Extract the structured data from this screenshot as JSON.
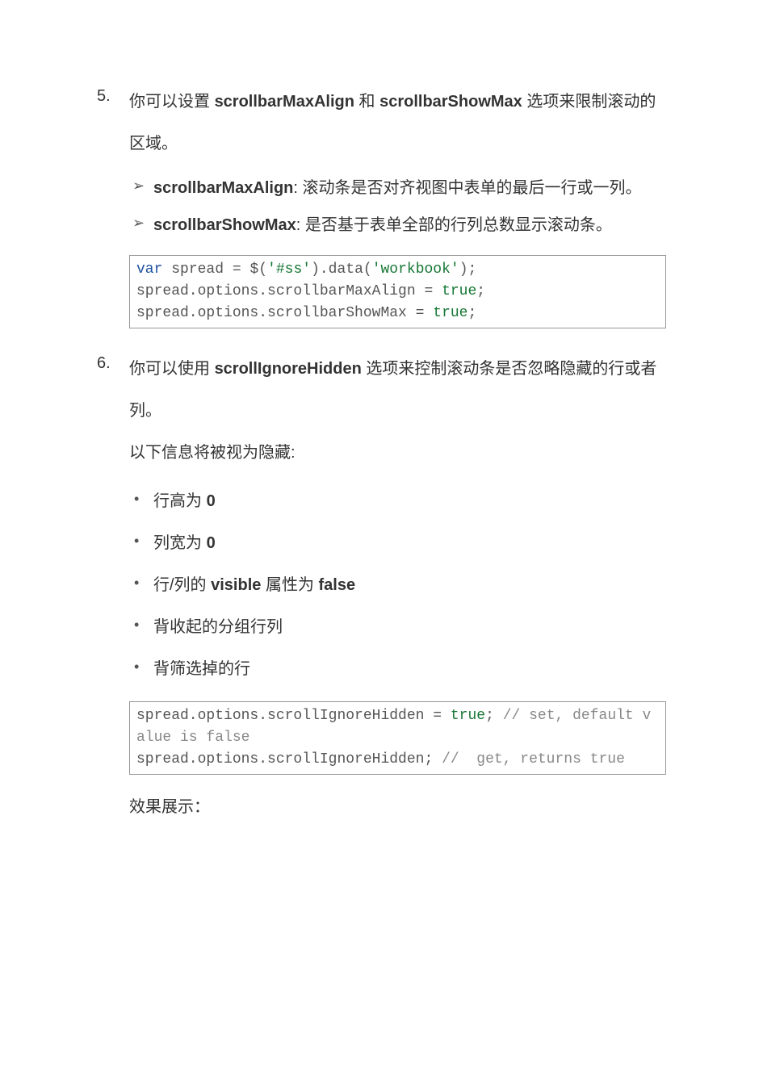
{
  "items": [
    {
      "number": "5.",
      "text_parts": {
        "p1": "你可以设置 ",
        "kw1": "scrollbarMaxAlign",
        "p2": " 和 ",
        "kw2": "scrollbarShowMax",
        "p3": " 选项来限制滚动的区域。"
      },
      "arrow_bullets": [
        {
          "label": "scrollbarMaxAlign",
          "desc": ": 滚动条是否对齐视图中表单的最后一行或一列。"
        },
        {
          "label": "scrollbarShowMax",
          "desc": ": 是否基于表单全部的行列总数显示滚动条。"
        }
      ],
      "code": {
        "kw_var": "var",
        "id_spread": "spread",
        "eq": " = ",
        "dollar": "$(",
        "str_sel": "'#ss'",
        "after_sel": ").data(",
        "str_wb": "'workbook'",
        "close1": ");",
        "line2_a": "spread.options.scrollbarMaxAlign = ",
        "true1": "true",
        "semi": ";",
        "line3_a": "spread.options.scrollbarShowMax = ",
        "true2": "true"
      }
    },
    {
      "number": "6.",
      "text_parts": {
        "p1": "你可以使用  ",
        "kw1": "scrollIgnoreHidden",
        "p2": " 选项来控制滚动条是否忽略隐藏的行或者列。"
      },
      "intro": "以下信息将被视为隐藏:",
      "dot_bullets": [
        {
          "pre": "行高为 ",
          "bold": "0",
          "post": ""
        },
        {
          "pre": "列宽为 ",
          "bold": "0",
          "post": ""
        },
        {
          "pre": "行/列的 ",
          "bold": "visible",
          "mid": " 属性为 ",
          "bold2": "false"
        },
        {
          "pre": "背收起的分组行列",
          "bold": "",
          "post": ""
        },
        {
          "pre": "背筛选掉的行",
          "bold": "",
          "post": ""
        }
      ],
      "code": {
        "line1_a": "spread.options.scrollIgnoreHidden = ",
        "true1": "true",
        "line1_b": "; ",
        "com1": "// set, default value is false",
        "line2_a": "spread.options.scrollIgnoreHidden; ",
        "com2": "//  get, returns true"
      },
      "result_label": "效果展示："
    }
  ]
}
